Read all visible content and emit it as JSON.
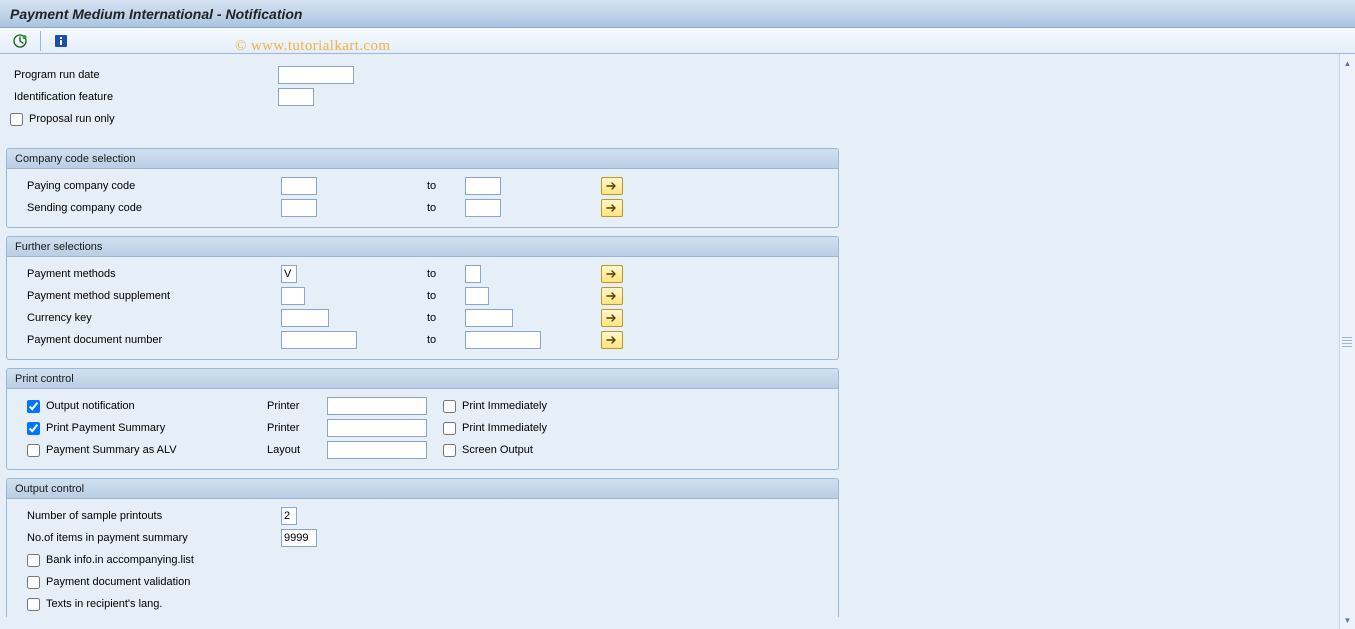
{
  "title": "Payment Medium International - Notification",
  "watermark": "© www.tutorialkart.com",
  "toolbar": {
    "execute_icon": "execute",
    "info_icon": "info"
  },
  "top": {
    "program_run_date_label": "Program run date",
    "program_run_date_value": "",
    "identification_label": "Identification feature",
    "identification_value": "",
    "proposal_label": "Proposal run only",
    "proposal_checked": false
  },
  "group_company": {
    "title": "Company code selection",
    "paying_label": "Paying company code",
    "sending_label": "Sending company code",
    "to_label": "to",
    "paying_from": "",
    "paying_to": "",
    "sending_from": "",
    "sending_to": ""
  },
  "group_further": {
    "title": "Further selections",
    "to_label": "to",
    "pm_label": "Payment methods",
    "pm_from": "V",
    "pm_to": "",
    "pms_label": "Payment method supplement",
    "pms_from": "",
    "pms_to": "",
    "cur_label": "Currency key",
    "cur_from": "",
    "cur_to": "",
    "pdn_label": "Payment document number",
    "pdn_from": "",
    "pdn_to": ""
  },
  "group_print": {
    "title": "Print control",
    "out_notif_label": "Output notification",
    "out_notif_checked": true,
    "print_sum_label": "Print Payment Summary",
    "print_sum_checked": true,
    "alv_label": "Payment Summary as ALV",
    "alv_checked": false,
    "printer_label": "Printer",
    "layout_label": "Layout",
    "printer1_value": "",
    "printer2_value": "",
    "layout_value": "",
    "print_imm_label": "Print Immediately",
    "print_imm1_checked": false,
    "print_imm2_checked": false,
    "screen_out_label": "Screen Output",
    "screen_out_checked": false
  },
  "group_output": {
    "title": "Output control",
    "samples_label": "Number of sample printouts",
    "samples_value": "2",
    "items_label": "No.of items in payment summary",
    "items_value": "9999",
    "bank_info_label": "Bank info.in accompanying.list",
    "bank_info_checked": false,
    "pdv_label": "Payment document validation",
    "pdv_checked": false,
    "texts_lang_label": "Texts in recipient's lang.",
    "texts_lang_checked": false
  }
}
